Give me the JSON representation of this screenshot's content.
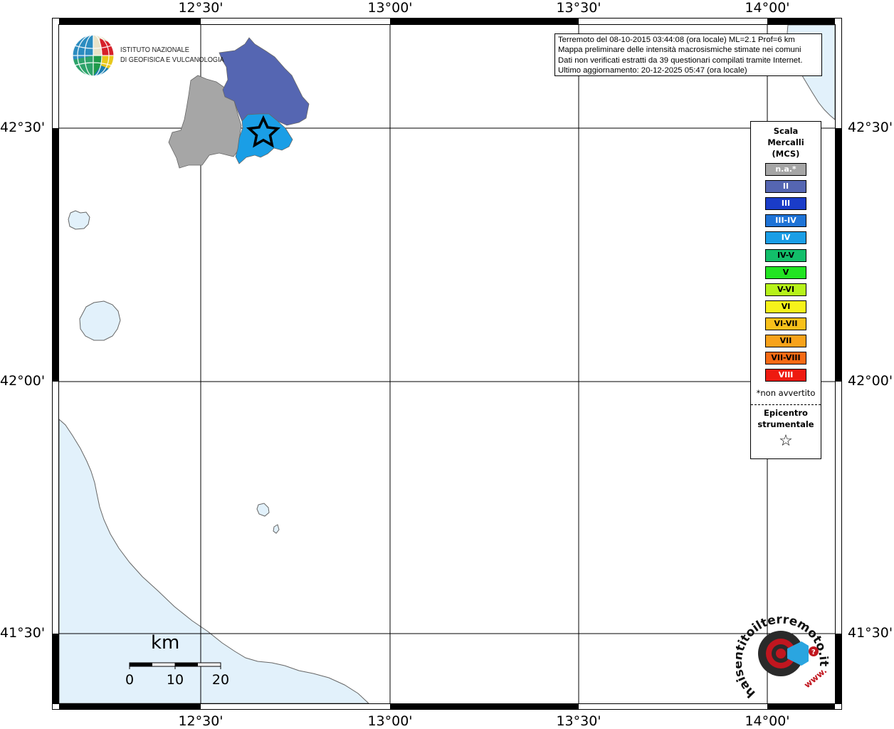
{
  "map": {
    "lon_labels": [
      "12°30'",
      "13°00'",
      "13°30'",
      "14°00'"
    ],
    "lat_labels": [
      "42°30'",
      "42°00'",
      "41°30'"
    ],
    "colors": {
      "sea": "#e2f1fb",
      "region_na": "#a6a6a6",
      "region_II": "#5566b2",
      "region_IV": "#1a9ee6"
    },
    "epicenter_marker": "star-icon"
  },
  "info": {
    "line1": "Terremoto del 08-10-2015 03:44:08 (ora locale) ML=2.1 Prof=6 km",
    "line2": "Mappa preliminare delle intensità macrosismiche stimate nei comuni",
    "line3": "Dati non verificati estratti da 39 questionari compilati tramite Internet.",
    "line4": "Ultimo aggiornamento: 20-12-2025 05:47 (ora locale)"
  },
  "logo": {
    "line1": "ISTITUTO NAZIONALE",
    "line2": "DI GEOFISICA E VULCANOLOGIA"
  },
  "legend": {
    "title": "Scala Mercalli (MCS)",
    "items": [
      {
        "label": "n.a.*",
        "color": "#a6a6a6",
        "text_color": "#ffffff"
      },
      {
        "label": "II",
        "color": "#5566b2",
        "text_color": "#ffffff"
      },
      {
        "label": "III",
        "color": "#1a3cc8",
        "text_color": "#ffffff"
      },
      {
        "label": "III-IV",
        "color": "#1e73d6",
        "text_color": "#ffffff"
      },
      {
        "label": "IV",
        "color": "#1a9ee6",
        "text_color": "#ffffff"
      },
      {
        "label": "IV-V",
        "color": "#12be6a",
        "text_color": "#000000"
      },
      {
        "label": "V",
        "color": "#22e422",
        "text_color": "#000000"
      },
      {
        "label": "V-VI",
        "color": "#b6f21a",
        "text_color": "#000000"
      },
      {
        "label": "VI",
        "color": "#f6f21a",
        "text_color": "#000000"
      },
      {
        "label": "VI-VII",
        "color": "#f8c01a",
        "text_color": "#000000"
      },
      {
        "label": "VII",
        "color": "#f8a21a",
        "text_color": "#000000"
      },
      {
        "label": "VII-VIII",
        "color": "#f66a14",
        "text_color": "#000000"
      },
      {
        "label": "VIII",
        "color": "#ee1a10",
        "text_color": "#ffffff"
      }
    ],
    "note": "*non avvertito",
    "epicenter_label": "Epicentro strumentale",
    "epicenter_symbol": "☆"
  },
  "scale_bar": {
    "unit": "km",
    "ticks": [
      "0",
      "10",
      "20"
    ]
  },
  "badge": {
    "text": "haisentitoilterremoto.it",
    "url_text": "www."
  }
}
